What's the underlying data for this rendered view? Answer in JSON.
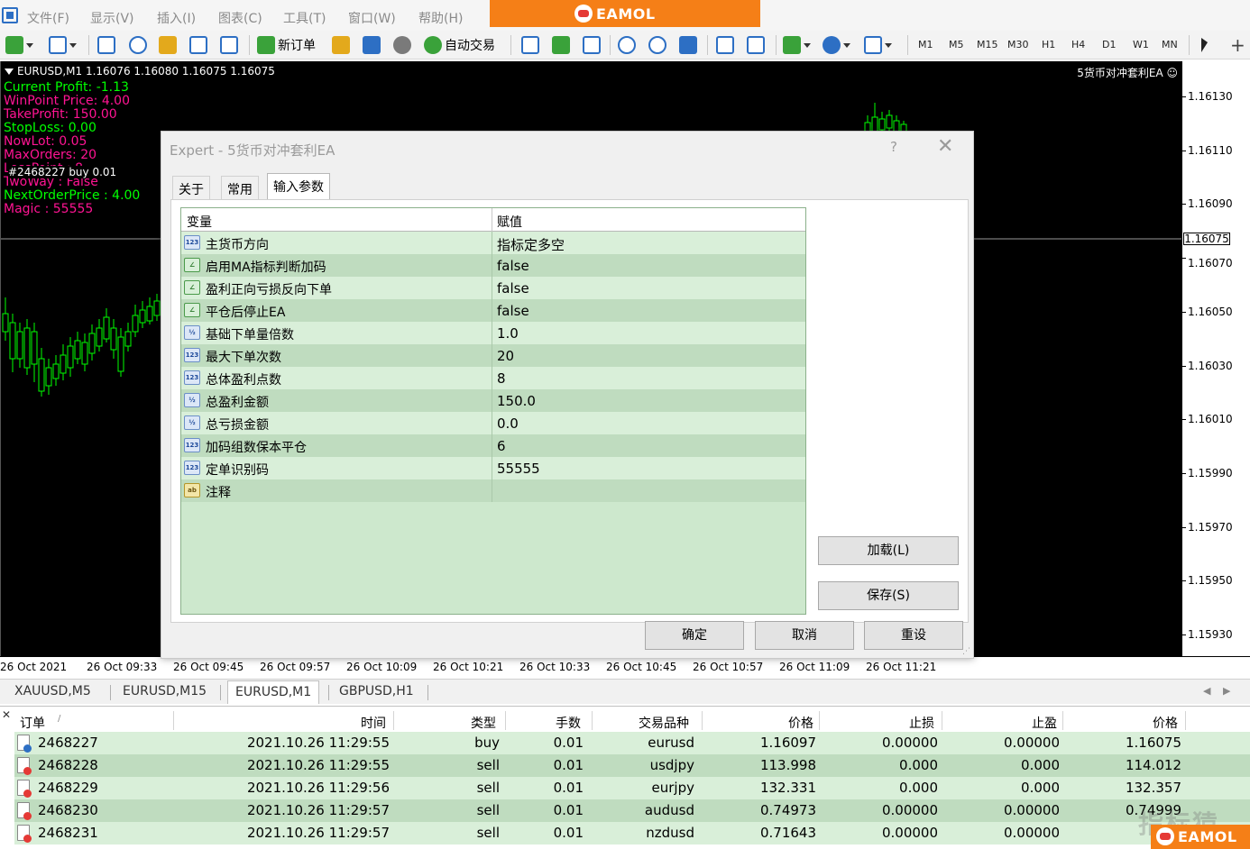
{
  "menubar": {
    "items": [
      "文件(F)",
      "显示(V)",
      "插入(I)",
      "图表(C)",
      "工具(T)",
      "窗口(W)",
      "帮助(H)"
    ],
    "brand": "EAMOL"
  },
  "toolbar": {
    "new_order_label": "新订单",
    "auto_trade_label": "自动交易",
    "timeframes": [
      "M1",
      "M5",
      "M15",
      "M30",
      "H1",
      "H4",
      "D1",
      "W1",
      "MN"
    ]
  },
  "chart": {
    "header": "EURUSD,M1  1.16076 1.16080 1.16075 1.16075",
    "ea_name": "5货币对冲套利EA ☺",
    "order_line_label": "#2468227 buy 0.01",
    "current_price": "1.16075",
    "info_lines": [
      {
        "text": "Current Profit:  -1.13",
        "color": "#00ff00"
      },
      {
        "text": "WinPoint Price:  4.00",
        "color": "#ff1493"
      },
      {
        "text": "TakeProfit:  150.00",
        "color": "#ff1493"
      },
      {
        "text": "StopLoss:  0.00",
        "color": "#00ff00"
      },
      {
        "text": "NowLot:  0.05",
        "color": "#ff1493"
      },
      {
        "text": "MaxOrders:  20",
        "color": "#ff1493"
      },
      {
        "text": "LossPoint :  8",
        "color": "#ff1493"
      },
      {
        "text": "TwoWay :  False",
        "color": "#ff1493"
      },
      {
        "text": "NextOrderPrice :  4.00",
        "color": "#00ff00"
      },
      {
        "text": "Magic :  55555",
        "color": "#ff1493"
      }
    ],
    "price_labels": [
      "1.16130",
      "1.16110",
      "1.16090",
      "1.16070",
      "1.16050",
      "1.16030",
      "1.16010",
      "1.15990",
      "1.15970",
      "1.15950",
      "1.15930"
    ],
    "time_labels": [
      "26 Oct 2021",
      "26 Oct 09:33",
      "26 Oct 09:45",
      "26 Oct 09:57",
      "26 Oct 10:09",
      "26 Oct 10:21",
      "26 Oct 10:33",
      "26 Oct 10:45",
      "26 Oct 10:57",
      "26 Oct 11:09",
      "26 Oct 11:21"
    ],
    "colors": {
      "background": "#000000",
      "bull": "#00ff00",
      "grid_line": "#00cc00"
    }
  },
  "dialog": {
    "title": "Expert - 5货币对冲套利EA",
    "help": "?",
    "close": "✕",
    "tabs": [
      "关于",
      "常用",
      "输入参数"
    ],
    "active_tab": "输入参数",
    "columns": {
      "variable": "变量",
      "value": "赋值"
    },
    "params": [
      {
        "icon": "123",
        "type": "int",
        "name": "主货币方向",
        "value": "指标定多空"
      },
      {
        "icon": "∠",
        "type": "bool",
        "name": "启用MA指标判断加码",
        "value": "false"
      },
      {
        "icon": "∠",
        "type": "bool",
        "name": "盈利正向亏损反向下单",
        "value": "false"
      },
      {
        "icon": "∠",
        "type": "bool",
        "name": "平仓后停止EA",
        "value": "false"
      },
      {
        "icon": "½",
        "type": "double",
        "name": "基础下单量倍数",
        "value": "1.0"
      },
      {
        "icon": "123",
        "type": "int",
        "name": "最大下单次数",
        "value": "20"
      },
      {
        "icon": "123",
        "type": "int",
        "name": "总体盈利点数",
        "value": "8"
      },
      {
        "icon": "½",
        "type": "double",
        "name": "总盈利金额",
        "value": "150.0"
      },
      {
        "icon": "½",
        "type": "double",
        "name": "总亏损金额",
        "value": "0.0"
      },
      {
        "icon": "123",
        "type": "int",
        "name": "加码组数保本平仓",
        "value": "6"
      },
      {
        "icon": "123",
        "type": "int",
        "name": "定单识别码",
        "value": "55555"
      },
      {
        "icon": "ab",
        "type": "string",
        "name": "注释",
        "value": ""
      }
    ],
    "buttons": {
      "load": "加载(L)",
      "save": "保存(S)",
      "ok": "确定",
      "cancel": "取消",
      "reset": "重设"
    }
  },
  "chart_tabs": {
    "items": [
      "XAUUSD,M5",
      "EURUSD,M15",
      "EURUSD,M1",
      "GBPUSD,H1"
    ],
    "active": "EURUSD,M1"
  },
  "orders": {
    "columns": [
      "订单",
      "时间",
      "类型",
      "手数",
      "交易品种",
      "价格",
      "止损",
      "止盈",
      "价格"
    ],
    "rows": [
      {
        "ticket": "2468227",
        "time": "2021.10.26 11:29:55",
        "type": "buy",
        "lots": "0.01",
        "symbol": "eurusd",
        "price": "1.16097",
        "sl": "0.00000",
        "tp": "0.00000",
        "current": "1.16075"
      },
      {
        "ticket": "2468228",
        "time": "2021.10.26 11:29:55",
        "type": "sell",
        "lots": "0.01",
        "symbol": "usdjpy",
        "price": "113.998",
        "sl": "0.000",
        "tp": "0.000",
        "current": "114.012"
      },
      {
        "ticket": "2468229",
        "time": "2021.10.26 11:29:56",
        "type": "sell",
        "lots": "0.01",
        "symbol": "eurjpy",
        "price": "132.331",
        "sl": "0.000",
        "tp": "0.000",
        "current": "132.357"
      },
      {
        "ticket": "2468230",
        "time": "2021.10.26 11:29:57",
        "type": "sell",
        "lots": "0.01",
        "symbol": "audusd",
        "price": "0.74973",
        "sl": "0.00000",
        "tp": "0.00000",
        "current": "0.74999"
      },
      {
        "ticket": "2468231",
        "time": "2021.10.26 11:29:57",
        "type": "sell",
        "lots": "0.01",
        "symbol": "nzdusd",
        "price": "0.71643",
        "sl": "0.00000",
        "tp": "0.00000",
        "current": "0.71"
      }
    ]
  },
  "watermark": "指标猿",
  "brand_corner": "EAMOL"
}
